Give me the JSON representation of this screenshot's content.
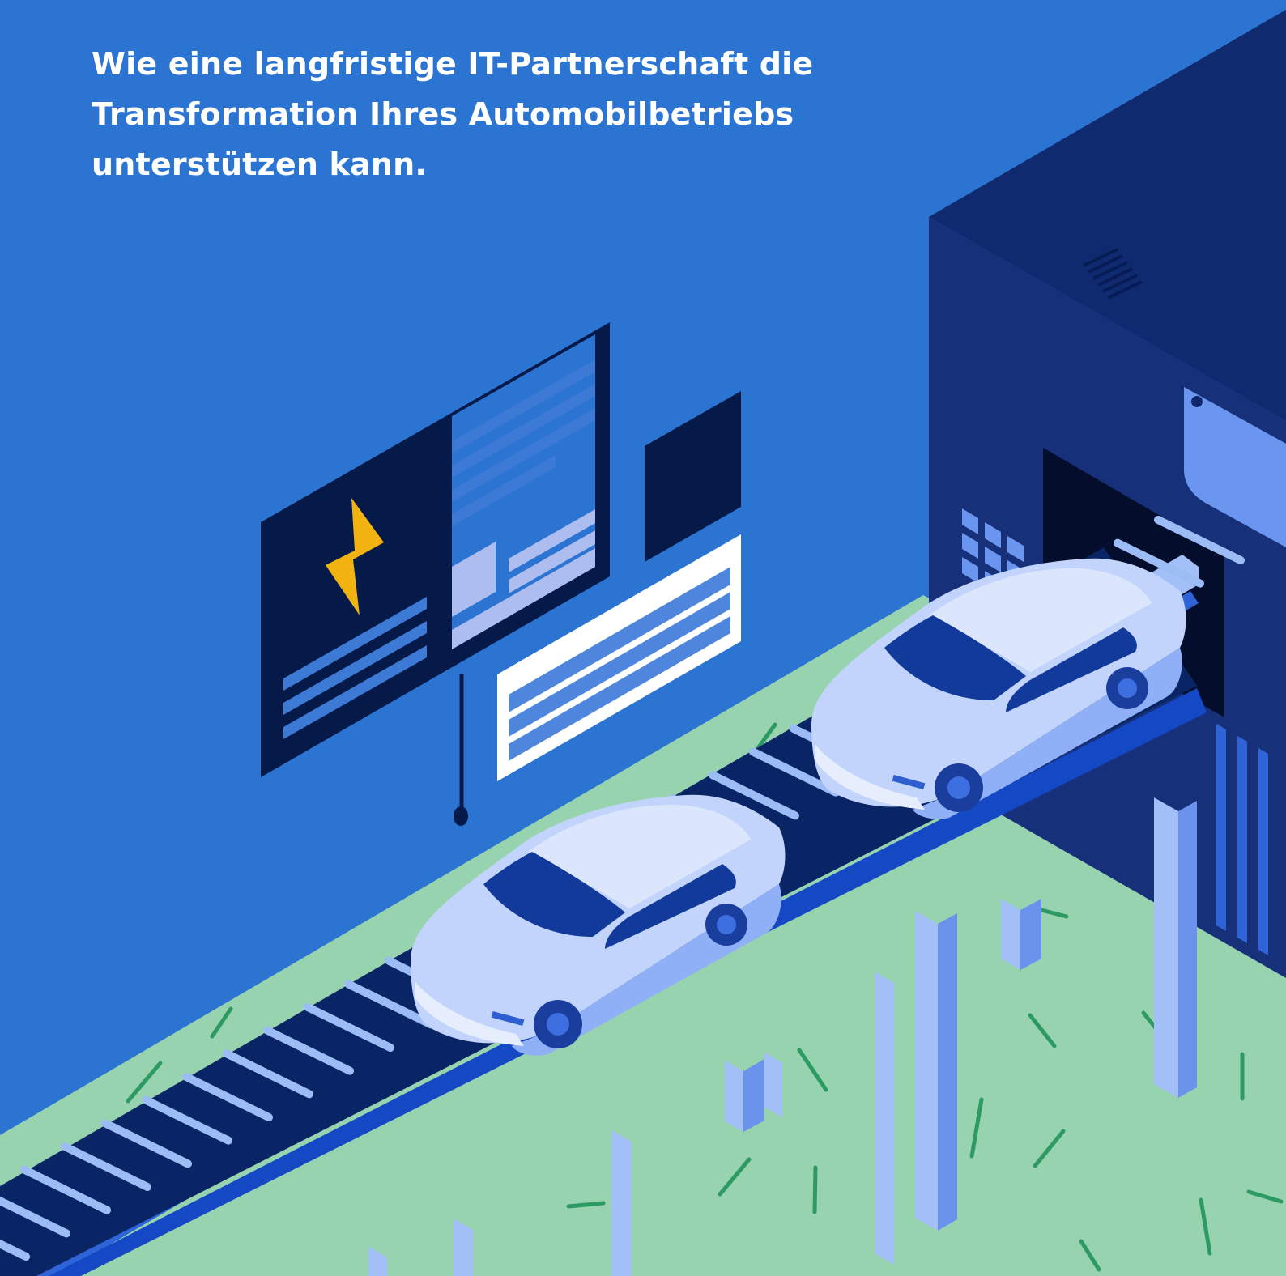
{
  "headline": {
    "lines": [
      "Wie eine langfristige IT-Partnerschaft die",
      "Transformation Ihres Automobilbetriebs",
      "unterstützen kann."
    ]
  },
  "palette": {
    "background": "#2b74d2",
    "grass": "#98d3b0",
    "grass_strokes": "#2e9a63",
    "factory_front": "#16307a",
    "factory_side": "#0f2a6e",
    "factory_top": "#1a3a8c",
    "door": "#050d2c",
    "panel_dark": "#061a49",
    "panel_stripe": "#3d7ad6",
    "panel_light": "#aebdf0",
    "bolt": "#f2b20f",
    "belt": "#0a2565",
    "belt_slat": "#9cbcf6",
    "pillar": "#a3bff8",
    "pillar_shade": "#6b93eb",
    "car_body": "#c2d4fb",
    "car_roof": "#dbe6fd",
    "car_glass": "#123a9b",
    "car_wheel": "#1a3e9e"
  },
  "icons": [
    "lightning-bolt-icon"
  ]
}
